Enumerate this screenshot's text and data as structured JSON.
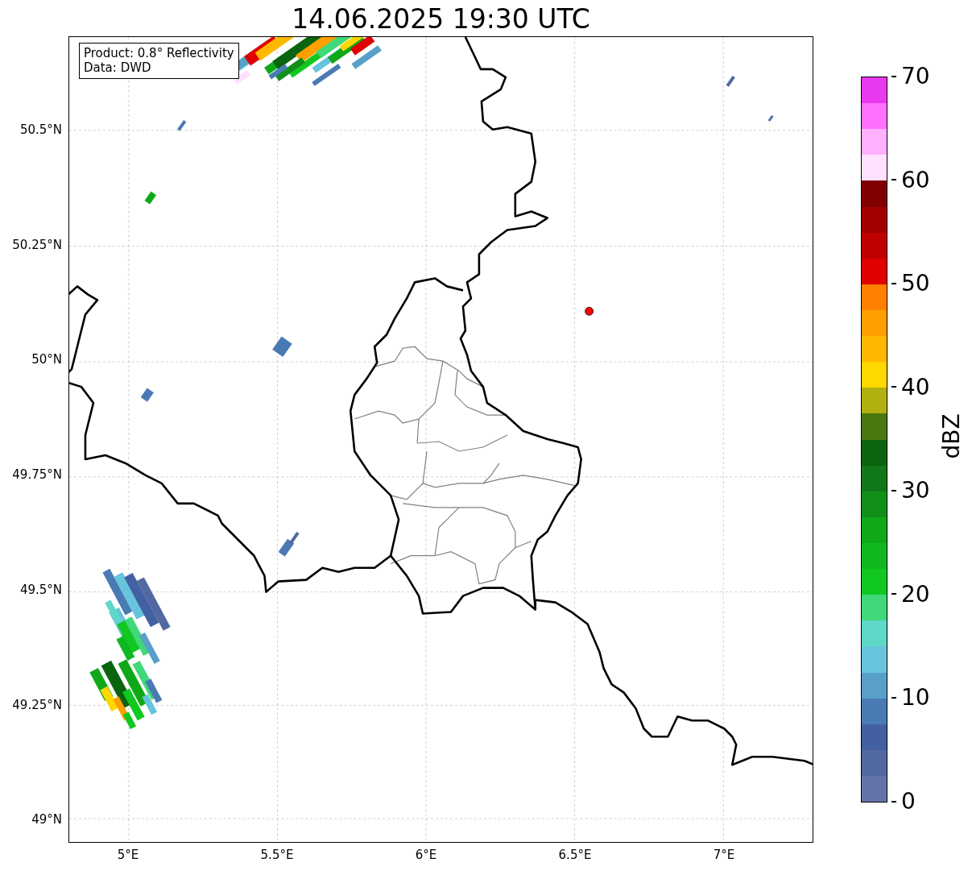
{
  "title": "14.06.2025 19:30 UTC",
  "legend": {
    "lines": [
      "Product: 0.8° Reflectivity",
      "Data: DWD"
    ]
  },
  "x_axis": {
    "ticks": [
      "5°E",
      "5.5°E",
      "6°E",
      "6.5°E",
      "7°E"
    ]
  },
  "y_axis": {
    "ticks": [
      "50.5°N",
      "50.25°N",
      "50°N",
      "49.75°N",
      "49.5°N",
      "49.25°N",
      "49°N"
    ]
  },
  "colorbar": {
    "label": "dBZ",
    "ticks": [
      "70",
      "60",
      "50",
      "40",
      "30",
      "20",
      "10",
      "0"
    ],
    "segments": [
      {
        "color": "#e838f0"
      },
      {
        "color": "#ff70ff"
      },
      {
        "color": "#ffb0ff"
      },
      {
        "color": "#ffe0ff"
      },
      {
        "color": "#800000"
      },
      {
        "color": "#a00000"
      },
      {
        "color": "#c00000"
      },
      {
        "color": "#e00000"
      },
      {
        "color": "#ff8000"
      },
      {
        "color": "#ffa000"
      },
      {
        "color": "#ffb800"
      },
      {
        "color": "#ffd800"
      },
      {
        "color": "#b0b010"
      },
      {
        "color": "#4a7810"
      },
      {
        "color": "#0a6410"
      },
      {
        "color": "#107818"
      },
      {
        "color": "#109018"
      },
      {
        "color": "#10a818"
      },
      {
        "color": "#10b820"
      },
      {
        "color": "#10c820"
      },
      {
        "color": "#40d878"
      },
      {
        "color": "#60d8c8"
      },
      {
        "color": "#68c4dc"
      },
      {
        "color": "#58a0c8"
      },
      {
        "color": "#4a7ab4"
      },
      {
        "color": "#4260a2"
      },
      {
        "color": "#5268a0"
      },
      {
        "color": "#6474a8"
      }
    ]
  }
}
